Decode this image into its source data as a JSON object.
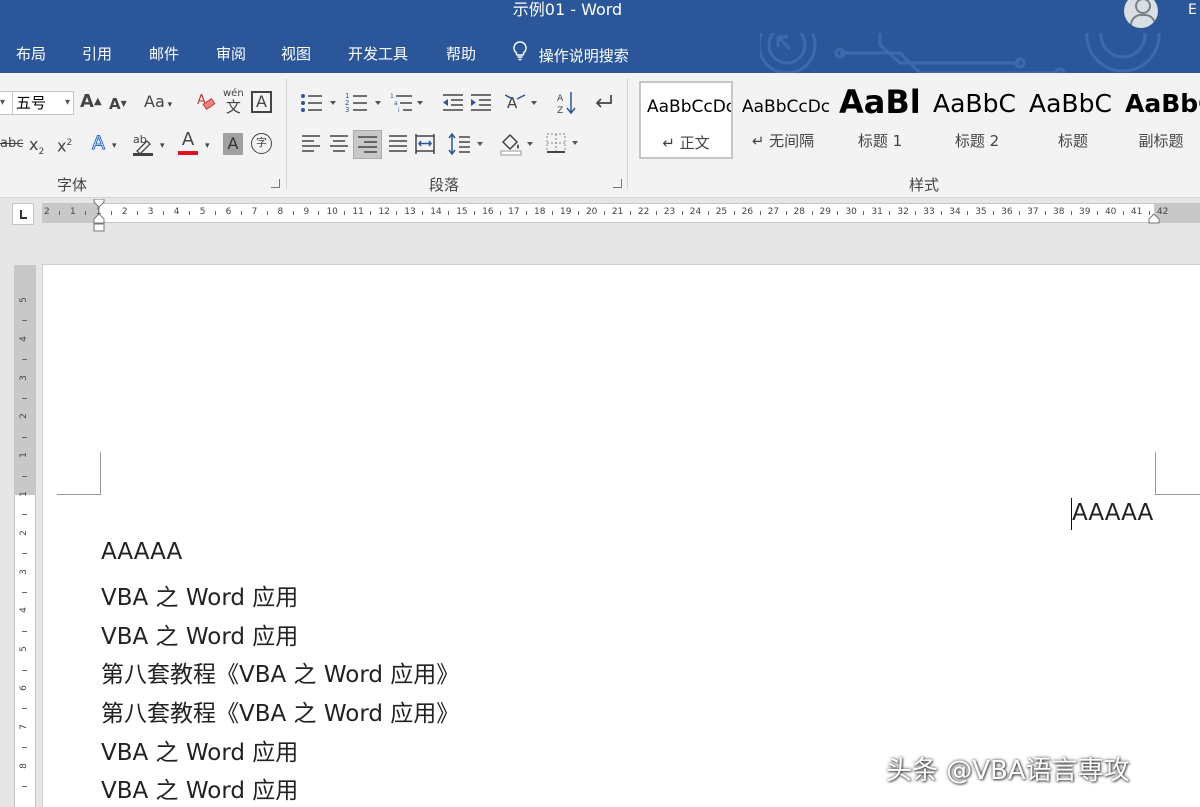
{
  "window": {
    "title": "示例01  -  Word",
    "share_glyph": "E"
  },
  "tabs": [
    "布局",
    "引用",
    "邮件",
    "审阅",
    "视图",
    "开发工具",
    "帮助"
  ],
  "tell_me": "操作说明搜索",
  "font_group": {
    "label": "字体",
    "font_size": "五号",
    "change_case": "Aa",
    "phonetic": "wén",
    "phonetic_char": "文",
    "char_border": "A",
    "strike": "abc",
    "subscript": "x",
    "superscript": "x",
    "font_color": "A",
    "font_color_value": "#e81123",
    "shading": "A",
    "enclose": "字"
  },
  "paragraph_group": {
    "label": "段落"
  },
  "styles_group": {
    "label": "样式",
    "items": [
      {
        "preview": "AaBbCcDc",
        "name": "↵ 正文"
      },
      {
        "preview": "AaBbCcDc",
        "name": "↵ 无间隔"
      },
      {
        "preview": "AaBl",
        "name": "标题 1"
      },
      {
        "preview": "AaBbC",
        "name": "标题 2"
      },
      {
        "preview": "AaBbC",
        "name": "标题"
      },
      {
        "preview": "AaBbC",
        "name": "副标题"
      }
    ]
  },
  "ruler": {
    "horizontal": [
      "2",
      "1",
      "1",
      "2",
      "3",
      "4",
      "5",
      "6",
      "7",
      "8",
      "9",
      "10",
      "11",
      "12",
      "13",
      "14",
      "15",
      "16",
      "17",
      "18",
      "19",
      "20",
      "21",
      "22",
      "23",
      "24",
      "25",
      "26",
      "27",
      "28",
      "29",
      "30",
      "31",
      "32",
      "33",
      "34",
      "35",
      "36",
      "37",
      "38",
      "39",
      "40",
      "41",
      "42"
    ],
    "vertical": [
      "5",
      "4",
      "3",
      "2",
      "1",
      "1",
      "2",
      "3",
      "4",
      "5",
      "6",
      "7",
      "8"
    ]
  },
  "document": {
    "header_right": "AAAAA",
    "lines": [
      "AAAAA",
      "VBA 之 Word 应用",
      "VBA 之 Word 应用",
      "第八套教程《VBA 之 Word 应用》",
      "第八套教程《VBA 之 Word 应用》",
      "VBA 之 Word 应用",
      "VBA 之 Word 应用"
    ]
  },
  "watermark": "头条 @VBA语言専攻"
}
